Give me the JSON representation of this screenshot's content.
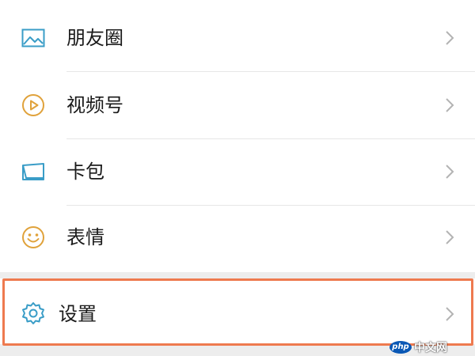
{
  "menu": {
    "items": [
      {
        "label": "朋友圈",
        "icon": "moments-picture-icon",
        "icon_color": "#3a9dc7"
      },
      {
        "label": "视频号",
        "icon": "channels-play-icon",
        "icon_color": "#e0a23b"
      },
      {
        "label": "卡包",
        "icon": "card-wallet-icon",
        "icon_color": "#3a9dc7"
      },
      {
        "label": "表情",
        "icon": "sticker-smiley-icon",
        "icon_color": "#e0a23b"
      }
    ],
    "settings": {
      "label": "设置",
      "icon": "gear-icon",
      "icon_color": "#3a9dc7"
    }
  },
  "highlight": {
    "color": "#ee7a4f"
  },
  "watermark": {
    "logo": "php",
    "text": "中文网"
  }
}
